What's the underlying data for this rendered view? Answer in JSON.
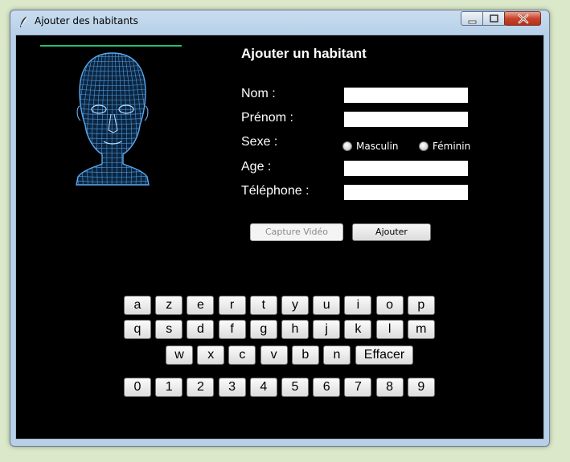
{
  "window": {
    "title": "Ajouter des habitants"
  },
  "form": {
    "heading": "Ajouter un habitant",
    "fields": {
      "nom": {
        "label": "Nom :",
        "value": ""
      },
      "prenom": {
        "label": "Prénom :",
        "value": ""
      },
      "sexe": {
        "label": "Sexe :",
        "options": [
          "Masculin",
          "Féminin"
        ]
      },
      "age": {
        "label": "Age :",
        "value": ""
      },
      "telephone": {
        "label": "Téléphone :",
        "value": ""
      }
    },
    "buttons": {
      "capture": "Capture Vidéo",
      "ajouter": "Ajouter"
    }
  },
  "keyboard": {
    "row1": [
      "a",
      "z",
      "e",
      "r",
      "t",
      "y",
      "u",
      "i",
      "o",
      "p"
    ],
    "row2": [
      "q",
      "s",
      "d",
      "f",
      "g",
      "h",
      "j",
      "k",
      "l",
      "m"
    ],
    "row3": [
      "w",
      "x",
      "c",
      "v",
      "b",
      "n"
    ],
    "erase": "Effacer",
    "digits": [
      "0",
      "1",
      "2",
      "3",
      "4",
      "5",
      "6",
      "7",
      "8",
      "9"
    ]
  },
  "icons": {
    "app": "feather-icon",
    "face": "wireframe-head-icon"
  },
  "colors": {
    "accent_line": "#1fbf6e",
    "face_wire": "#5aa9f0",
    "background": "#000000"
  }
}
